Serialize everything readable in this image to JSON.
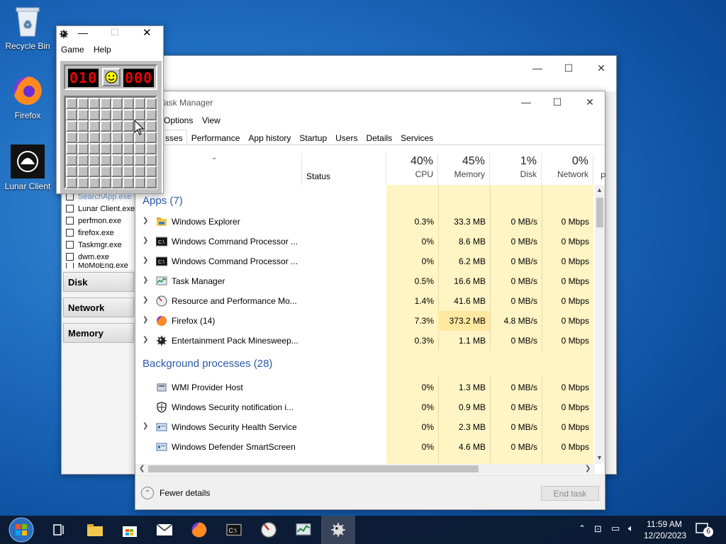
{
  "desktop": {
    "icons": [
      {
        "label": "Recycle Bin"
      },
      {
        "label": "Firefox"
      },
      {
        "label": "Lunar Client"
      }
    ]
  },
  "perfmon": {
    "processes": [
      "SearchApp.exe",
      "Lunar Client.exe",
      "perfmon.exe",
      "firefox.exe",
      "Taskmgr.exe",
      "dwm.exe",
      "MoMoEng.exe"
    ],
    "sections": [
      "Disk",
      "Network",
      "Memory"
    ]
  },
  "taskmanager": {
    "title": "Task Manager",
    "menu": [
      "Options",
      "View"
    ],
    "tabs": [
      "Processes",
      "Performance",
      "App history",
      "Startup",
      "Users",
      "Details",
      "Services"
    ],
    "active_tab_visible": "sses",
    "columns": {
      "status": "Status",
      "cpu": {
        "pct": "40%",
        "label": "CPU"
      },
      "memory": {
        "pct": "45%",
        "label": "Memory"
      },
      "disk": {
        "pct": "1%",
        "label": "Disk"
      },
      "network": {
        "pct": "0%",
        "label": "Network"
      },
      "power": "P"
    },
    "apps_header": "Apps (7)",
    "apps": [
      {
        "name": "Windows Explorer",
        "cpu": "0.3%",
        "mem": "33.3 MB",
        "disk": "0 MB/s",
        "net": "0 Mbps"
      },
      {
        "name": "Windows Command Processor ...",
        "cpu": "0%",
        "mem": "8.6 MB",
        "disk": "0 MB/s",
        "net": "0 Mbps"
      },
      {
        "name": "Windows Command Processor ...",
        "cpu": "0%",
        "mem": "6.2 MB",
        "disk": "0 MB/s",
        "net": "0 Mbps"
      },
      {
        "name": "Task Manager",
        "cpu": "0.5%",
        "mem": "16.6 MB",
        "disk": "0 MB/s",
        "net": "0 Mbps"
      },
      {
        "name": "Resource and Performance Mo...",
        "cpu": "1.4%",
        "mem": "41.6 MB",
        "disk": "0 MB/s",
        "net": "0 Mbps"
      },
      {
        "name": "Firefox (14)",
        "cpu": "7.3%",
        "mem": "373.2 MB",
        "disk": "4.8 MB/s",
        "net": "0 Mbps"
      },
      {
        "name": "Entertainment Pack Minesweep...",
        "cpu": "0.3%",
        "mem": "1.1 MB",
        "disk": "0 MB/s",
        "net": "0 Mbps"
      }
    ],
    "bg_header": "Background processes (28)",
    "background": [
      {
        "name": "WMI Provider Host",
        "cpu": "0%",
        "mem": "1.3 MB",
        "disk": "0 MB/s",
        "net": "0 Mbps"
      },
      {
        "name": "Windows Security notification i...",
        "cpu": "0%",
        "mem": "0.9 MB",
        "disk": "0 MB/s",
        "net": "0 Mbps"
      },
      {
        "name": "Windows Security Health Service",
        "cpu": "0%",
        "mem": "2.3 MB",
        "disk": "0 MB/s",
        "net": "0 Mbps"
      },
      {
        "name": "Windows Defender SmartScreen",
        "cpu": "0%",
        "mem": "4.6 MB",
        "disk": "0 MB/s",
        "net": "0 Mbps"
      }
    ],
    "fewer_details": "Fewer details",
    "end_task": "End task"
  },
  "minesweeper": {
    "menu": [
      "Game",
      "Help"
    ],
    "mines_left": "010",
    "timer": "000"
  },
  "taskbar": {
    "time": "11:59 AM",
    "date": "12/20/2023",
    "notifications": "6"
  }
}
